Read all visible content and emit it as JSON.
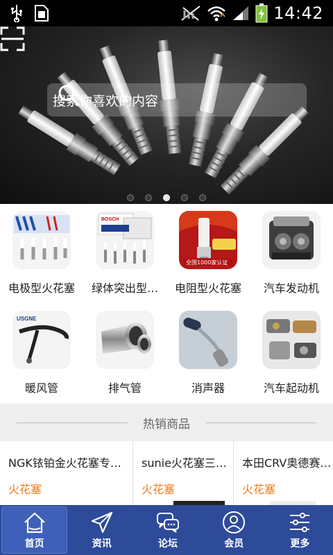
{
  "status_bar": {
    "time": "14:42",
    "icons": [
      "usb-icon",
      "sim-card-icon",
      "no-sim-icon",
      "wifi-icon",
      "signal-icon",
      "battery-charging-icon"
    ]
  },
  "banner": {
    "search_placeholder": "搜索你喜欢的内容",
    "slide_count": 5,
    "active_slide": 3,
    "scan_icon": "scan-icon",
    "search_icon": "search-icon"
  },
  "categories": [
    {
      "label": "电极型火花塞"
    },
    {
      "label": "绿体突出型…"
    },
    {
      "label": "电阻型火花塞"
    },
    {
      "label": "汽车发动机"
    },
    {
      "label": "暖风管"
    },
    {
      "label": "排气管"
    },
    {
      "label": "消声器"
    },
    {
      "label": "汽车起动机"
    }
  ],
  "section": {
    "title": "热销商品"
  },
  "products": [
    {
      "name": "NGK铱铂金火花塞专…",
      "tag": "火花塞"
    },
    {
      "name": "sunie火花塞三…",
      "tag": "火花塞"
    },
    {
      "name": "本田CRV奥德赛…",
      "tag": "火花塞"
    }
  ],
  "nav": [
    {
      "label": "首页",
      "icon": "home-icon",
      "active": true
    },
    {
      "label": "资讯",
      "icon": "send-icon"
    },
    {
      "label": "论坛",
      "icon": "chat-bubbles-icon"
    },
    {
      "label": "会员",
      "icon": "user-icon"
    },
    {
      "label": "更多",
      "icon": "sliders-icon"
    }
  ],
  "colors": {
    "nav_bg": "#2e4b9a",
    "tag_orange": "#f07a1c",
    "section_bg": "#efefef"
  }
}
